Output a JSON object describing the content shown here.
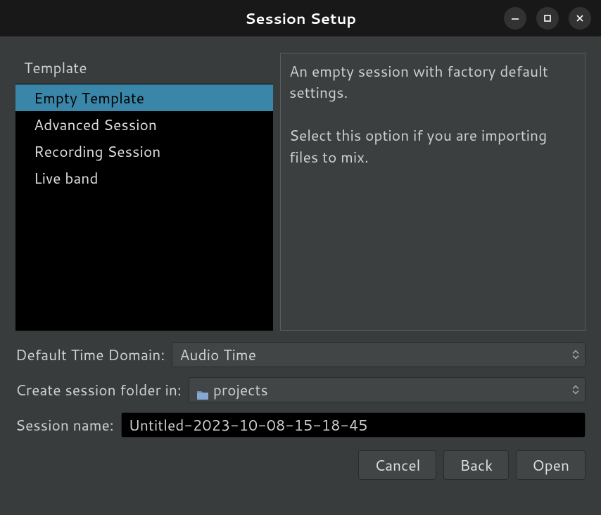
{
  "window": {
    "title": "Session Setup"
  },
  "template": {
    "header": "Template",
    "items": [
      {
        "label": "Empty Template",
        "selected": true
      },
      {
        "label": "Advanced Session",
        "selected": false
      },
      {
        "label": "Recording Session",
        "selected": false
      },
      {
        "label": "Live band",
        "selected": false
      }
    ]
  },
  "description": "An empty session with factory default settings.\n\nSelect this option if you are importing files to mix.",
  "time_domain": {
    "label": "Default Time Domain:",
    "value": "Audio Time"
  },
  "folder": {
    "label": "Create session folder in:",
    "value": "projects"
  },
  "session_name": {
    "label": "Session name:",
    "value": "Untitled-2023-10-08-15-18-45"
  },
  "buttons": {
    "cancel": "Cancel",
    "back": "Back",
    "open": "Open"
  }
}
